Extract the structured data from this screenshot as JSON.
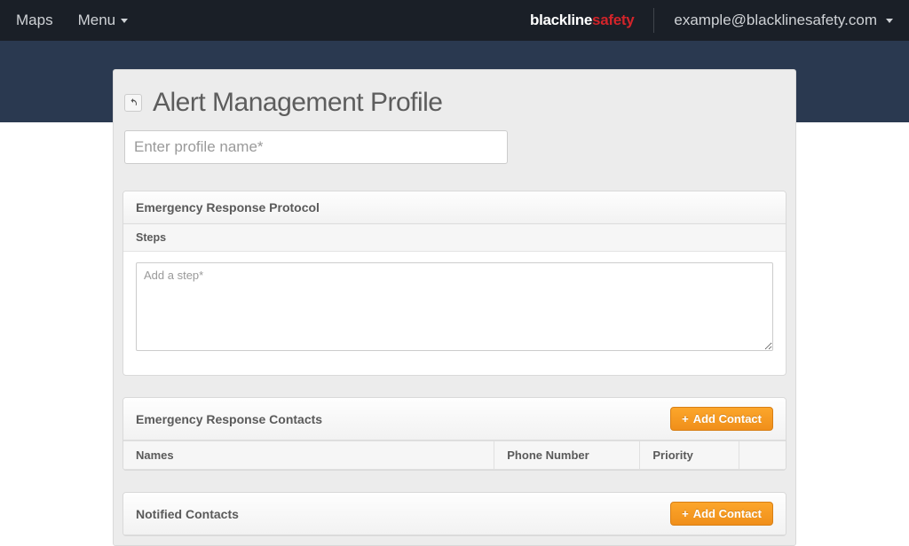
{
  "topbar": {
    "maps": "Maps",
    "menu": "Menu",
    "brand_primary": "blackline",
    "brand_accent": "safety",
    "account_email": "example@blacklinesafety.com"
  },
  "page": {
    "title": "Alert Management Profile",
    "profile_name_placeholder": "Enter profile name*"
  },
  "protocol": {
    "header": "Emergency Response Protocol",
    "steps_label": "Steps",
    "step_placeholder": "Add a step*"
  },
  "contacts_emergency": {
    "header": "Emergency Response Contacts",
    "add_button": "Add Contact",
    "columns": {
      "names": "Names",
      "phone": "Phone Number",
      "priority": "Priority"
    }
  },
  "contacts_notified": {
    "header": "Notified Contacts",
    "add_button": "Add Contact"
  }
}
